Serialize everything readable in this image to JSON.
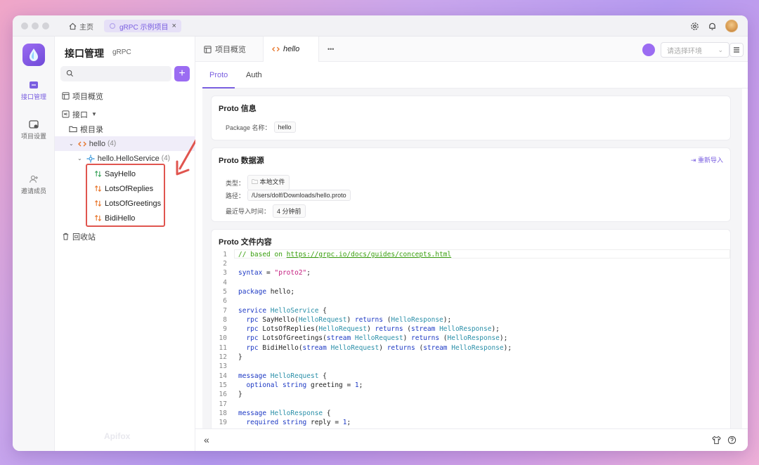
{
  "titlebar": {
    "home_label": "主页",
    "tab_label": "gRPC 示例项目",
    "tab_close": "×"
  },
  "rail": {
    "items": [
      {
        "label": "接口管理"
      },
      {
        "label": "项目设置"
      },
      {
        "label": "邀请成员"
      }
    ]
  },
  "sidebar": {
    "title": "接口管理",
    "subtitle": "gRPC",
    "add_button": "+",
    "overview": "项目概览",
    "interfaces": "接口",
    "root": "根目录",
    "proto_name": "hello",
    "proto_count": "(4)",
    "service_name": "hello.HelloService",
    "service_count": "(4)",
    "methods": [
      "SayHello",
      "LotsOfReplies",
      "LotsOfGreetings",
      "BidiHello"
    ],
    "recycle": "回收站",
    "watermark": "Apifox"
  },
  "main": {
    "tabs": [
      "项目概览",
      "hello"
    ],
    "more": "•••",
    "env_placeholder": "请选择环境",
    "subtabs": [
      "Proto",
      "Auth"
    ],
    "info": {
      "title": "Proto 信息",
      "pkg_label": "Package 名称：",
      "pkg_value": "hello"
    },
    "source": {
      "title": "Proto 数据源",
      "reimport": "重新导入",
      "type_label": "类型：",
      "type_value": "本地文件",
      "path_label": "路径：",
      "path_value": "/Users/dolf/Downloads/hello.proto",
      "time_label": "最近导入时间：",
      "time_value": "4 分钟前"
    },
    "file": {
      "title": "Proto 文件内容"
    },
    "footer_collapse": "«"
  },
  "colors": {
    "accent": "#7a5fe0",
    "highlight": "#e0554f"
  }
}
